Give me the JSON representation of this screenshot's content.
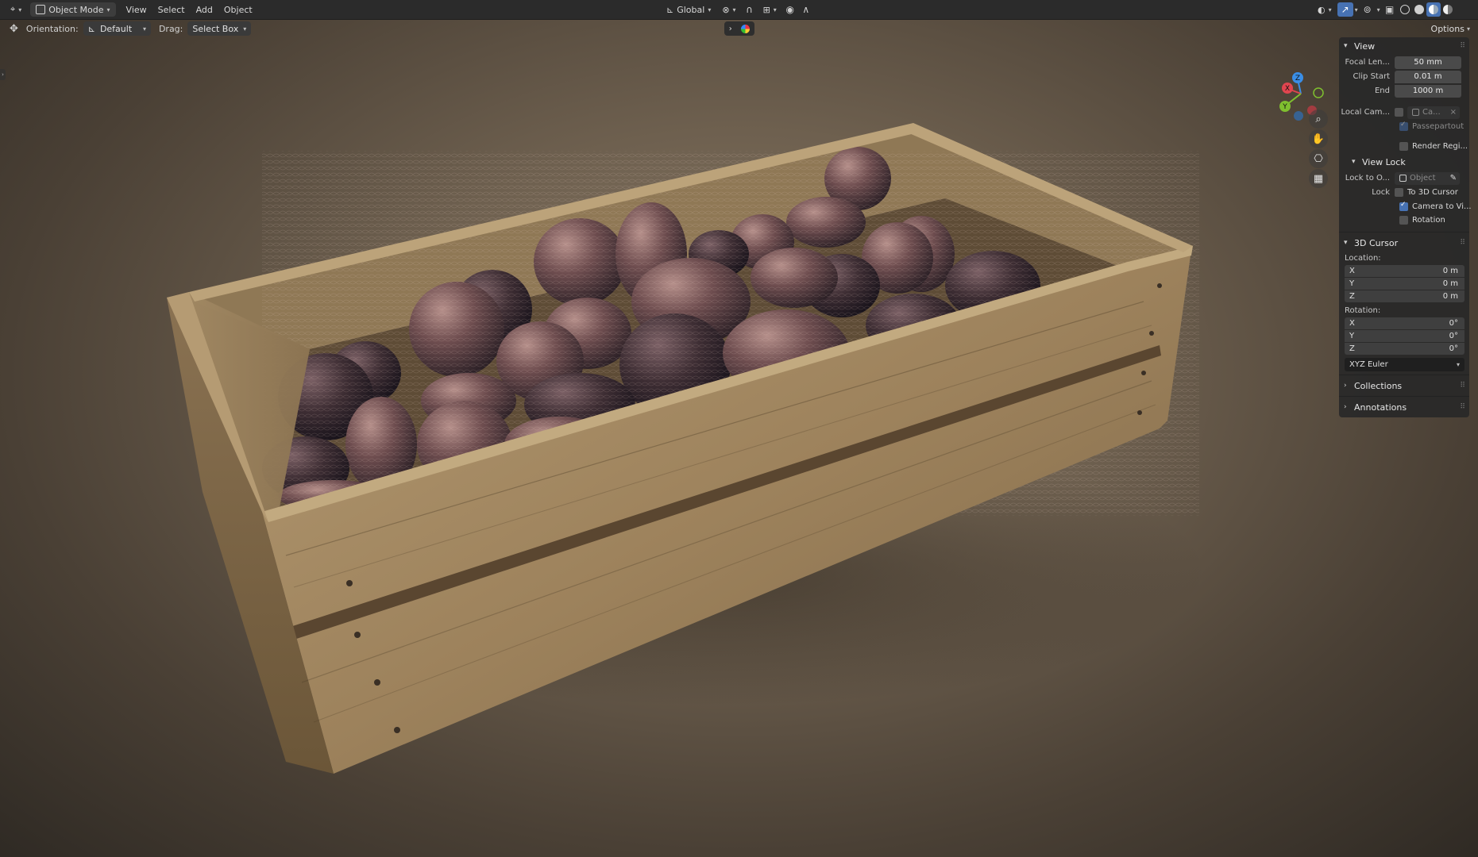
{
  "header": {
    "mode": "Object Mode",
    "menus": [
      "View",
      "Select",
      "Add",
      "Object"
    ],
    "transform_orientation": "Global",
    "options_label": "Options"
  },
  "toolbar": {
    "orientation_label": "Orientation:",
    "orientation_value": "Default",
    "drag_label": "Drag:",
    "drag_value": "Select Box"
  },
  "gizmo": {
    "axes": [
      "X",
      "Y",
      "Z"
    ],
    "colors": {
      "x": "#e0454f",
      "y": "#7fbf2f",
      "z": "#3a8ee6"
    }
  },
  "sidebar": {
    "view": {
      "title": "View",
      "focal_length_label": "Focal Len...",
      "focal_length": "50 mm",
      "clip_start_label": "Clip Start",
      "clip_start": "0.01 m",
      "clip_end_label": "End",
      "clip_end": "1000 m",
      "local_camera_label": "Local Cam...",
      "local_camera_value": "Ca...",
      "passepartout": "Passepartout",
      "render_region": "Render Regi..."
    },
    "view_lock": {
      "title": "View Lock",
      "lock_to_object_label": "Lock to O...",
      "lock_to_object_value": "Object",
      "lock_label": "Lock",
      "to_3d_cursor": "To 3D Cursor",
      "camera_to_view": "Camera to Vi...",
      "rotation": "Rotation"
    },
    "cursor": {
      "title": "3D Cursor",
      "location_label": "Location:",
      "location": [
        {
          "axis": "X",
          "value": "0 m"
        },
        {
          "axis": "Y",
          "value": "0 m"
        },
        {
          "axis": "Z",
          "value": "0 m"
        }
      ],
      "rotation_label": "Rotation:",
      "rotation": [
        {
          "axis": "X",
          "value": "0°"
        },
        {
          "axis": "Y",
          "value": "0°"
        },
        {
          "axis": "Z",
          "value": "0°"
        }
      ],
      "rotation_mode": "XYZ Euler"
    },
    "collections": "Collections",
    "annotations": "Annotations"
  }
}
